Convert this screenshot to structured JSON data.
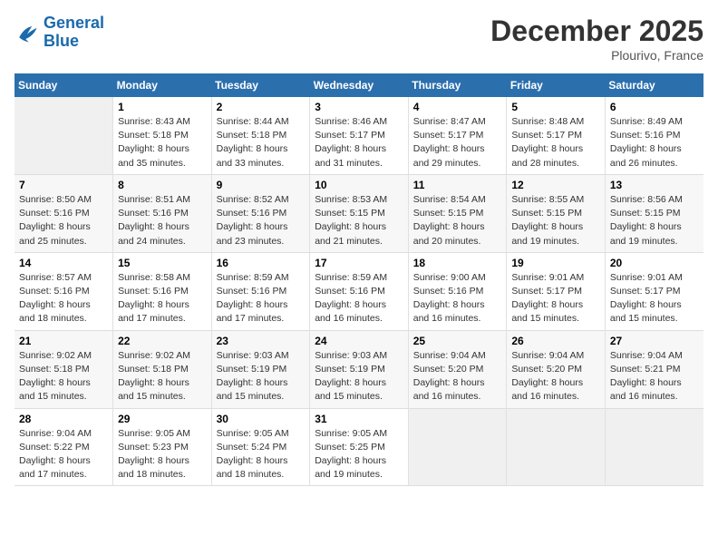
{
  "header": {
    "logo": {
      "line1": "General",
      "line2": "Blue"
    },
    "title": "December 2025",
    "location": "Plourivo, France"
  },
  "days_of_week": [
    "Sunday",
    "Monday",
    "Tuesday",
    "Wednesday",
    "Thursday",
    "Friday",
    "Saturday"
  ],
  "weeks": [
    [
      {
        "day": "",
        "info": ""
      },
      {
        "day": "1",
        "info": "Sunrise: 8:43 AM\nSunset: 5:18 PM\nDaylight: 8 hours\nand 35 minutes."
      },
      {
        "day": "2",
        "info": "Sunrise: 8:44 AM\nSunset: 5:18 PM\nDaylight: 8 hours\nand 33 minutes."
      },
      {
        "day": "3",
        "info": "Sunrise: 8:46 AM\nSunset: 5:17 PM\nDaylight: 8 hours\nand 31 minutes."
      },
      {
        "day": "4",
        "info": "Sunrise: 8:47 AM\nSunset: 5:17 PM\nDaylight: 8 hours\nand 29 minutes."
      },
      {
        "day": "5",
        "info": "Sunrise: 8:48 AM\nSunset: 5:17 PM\nDaylight: 8 hours\nand 28 minutes."
      },
      {
        "day": "6",
        "info": "Sunrise: 8:49 AM\nSunset: 5:16 PM\nDaylight: 8 hours\nand 26 minutes."
      }
    ],
    [
      {
        "day": "7",
        "info": "Sunrise: 8:50 AM\nSunset: 5:16 PM\nDaylight: 8 hours\nand 25 minutes."
      },
      {
        "day": "8",
        "info": "Sunrise: 8:51 AM\nSunset: 5:16 PM\nDaylight: 8 hours\nand 24 minutes."
      },
      {
        "day": "9",
        "info": "Sunrise: 8:52 AM\nSunset: 5:16 PM\nDaylight: 8 hours\nand 23 minutes."
      },
      {
        "day": "10",
        "info": "Sunrise: 8:53 AM\nSunset: 5:15 PM\nDaylight: 8 hours\nand 21 minutes."
      },
      {
        "day": "11",
        "info": "Sunrise: 8:54 AM\nSunset: 5:15 PM\nDaylight: 8 hours\nand 20 minutes."
      },
      {
        "day": "12",
        "info": "Sunrise: 8:55 AM\nSunset: 5:15 PM\nDaylight: 8 hours\nand 19 minutes."
      },
      {
        "day": "13",
        "info": "Sunrise: 8:56 AM\nSunset: 5:15 PM\nDaylight: 8 hours\nand 19 minutes."
      }
    ],
    [
      {
        "day": "14",
        "info": "Sunrise: 8:57 AM\nSunset: 5:16 PM\nDaylight: 8 hours\nand 18 minutes."
      },
      {
        "day": "15",
        "info": "Sunrise: 8:58 AM\nSunset: 5:16 PM\nDaylight: 8 hours\nand 17 minutes."
      },
      {
        "day": "16",
        "info": "Sunrise: 8:59 AM\nSunset: 5:16 PM\nDaylight: 8 hours\nand 17 minutes."
      },
      {
        "day": "17",
        "info": "Sunrise: 8:59 AM\nSunset: 5:16 PM\nDaylight: 8 hours\nand 16 minutes."
      },
      {
        "day": "18",
        "info": "Sunrise: 9:00 AM\nSunset: 5:16 PM\nDaylight: 8 hours\nand 16 minutes."
      },
      {
        "day": "19",
        "info": "Sunrise: 9:01 AM\nSunset: 5:17 PM\nDaylight: 8 hours\nand 15 minutes."
      },
      {
        "day": "20",
        "info": "Sunrise: 9:01 AM\nSunset: 5:17 PM\nDaylight: 8 hours\nand 15 minutes."
      }
    ],
    [
      {
        "day": "21",
        "info": "Sunrise: 9:02 AM\nSunset: 5:18 PM\nDaylight: 8 hours\nand 15 minutes."
      },
      {
        "day": "22",
        "info": "Sunrise: 9:02 AM\nSunset: 5:18 PM\nDaylight: 8 hours\nand 15 minutes."
      },
      {
        "day": "23",
        "info": "Sunrise: 9:03 AM\nSunset: 5:19 PM\nDaylight: 8 hours\nand 15 minutes."
      },
      {
        "day": "24",
        "info": "Sunrise: 9:03 AM\nSunset: 5:19 PM\nDaylight: 8 hours\nand 15 minutes."
      },
      {
        "day": "25",
        "info": "Sunrise: 9:04 AM\nSunset: 5:20 PM\nDaylight: 8 hours\nand 16 minutes."
      },
      {
        "day": "26",
        "info": "Sunrise: 9:04 AM\nSunset: 5:20 PM\nDaylight: 8 hours\nand 16 minutes."
      },
      {
        "day": "27",
        "info": "Sunrise: 9:04 AM\nSunset: 5:21 PM\nDaylight: 8 hours\nand 16 minutes."
      }
    ],
    [
      {
        "day": "28",
        "info": "Sunrise: 9:04 AM\nSunset: 5:22 PM\nDaylight: 8 hours\nand 17 minutes."
      },
      {
        "day": "29",
        "info": "Sunrise: 9:05 AM\nSunset: 5:23 PM\nDaylight: 8 hours\nand 18 minutes."
      },
      {
        "day": "30",
        "info": "Sunrise: 9:05 AM\nSunset: 5:24 PM\nDaylight: 8 hours\nand 18 minutes."
      },
      {
        "day": "31",
        "info": "Sunrise: 9:05 AM\nSunset: 5:25 PM\nDaylight: 8 hours\nand 19 minutes."
      },
      {
        "day": "",
        "info": ""
      },
      {
        "day": "",
        "info": ""
      },
      {
        "day": "",
        "info": ""
      }
    ]
  ]
}
